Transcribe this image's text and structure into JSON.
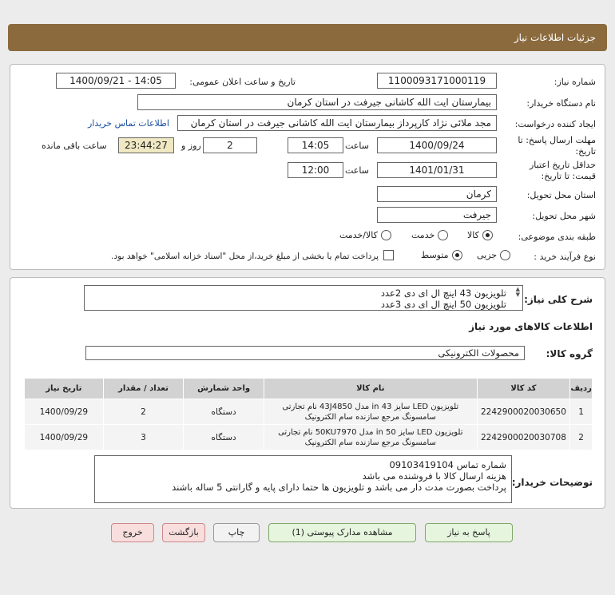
{
  "header": {
    "title": "جزئیات اطلاعات نیاز"
  },
  "form": {
    "need_number": {
      "label": "شماره نیاز:",
      "value": "1100093171000119"
    },
    "announce_datetime": {
      "label": "تاریخ و ساعت اعلان عمومی:",
      "value": "1400/09/21 - 14:05"
    },
    "buyer_org": {
      "label": "نام دستگاه خریدار:",
      "value": "بیمارستان ایت الله کاشانی جیرفت در استان کرمان"
    },
    "requester": {
      "label": "ایجاد کننده درخواست:",
      "value": "مجد ملائی نژاد کارپرداز بیمارستان ایت الله کاشانی جیرفت در استان کرمان",
      "contact_link": "اطلاعات تماس خریدار"
    },
    "reply_deadline": {
      "label_line1": "مهلت ارسال پاسخ: تا",
      "label_line2": "تاریخ:",
      "date": "1400/09/24",
      "time_label": "ساعت",
      "time": "14:05",
      "days": "2",
      "days_label": "روز و",
      "remaining": "23:44:27",
      "remaining_label": "ساعت باقی مانده"
    },
    "price_validity": {
      "label_line1": "حداقل تاریخ اعتبار",
      "label_line2": "قیمت: تا تاریخ:",
      "date": "1401/01/31",
      "time_label": "ساعت",
      "time": "12:00"
    },
    "delivery_province": {
      "label": "استان محل تحویل:",
      "value": "کرمان"
    },
    "delivery_city": {
      "label": "شهر محل تحویل:",
      "value": "جیرفت"
    },
    "category": {
      "label": "طبقه بندی موضوعی:",
      "options": [
        "کالا",
        "خدمت",
        "کالا/خدمت"
      ],
      "selected": "کالا"
    },
    "purchase_process": {
      "label": "نوع فرآیند خرید :",
      "options": [
        "جزیی",
        "متوسط"
      ],
      "selected": "متوسط",
      "note": "پرداخت تمام یا بخشی از مبلغ خرید،از محل \"اسناد خزانه اسلامی\" خواهد بود."
    }
  },
  "summary": {
    "label": "شرح کلی نیاز:",
    "lines": [
      "تلویزیون 43 اینچ ال ای دی 2عدد",
      "تلویزیون 50 اینچ ال ای دی 3عدد"
    ]
  },
  "goods": {
    "section_title": "اطلاعات کالاهای مورد نیاز",
    "group_label": "گروه کالا:",
    "group_value": "محصولات الکترونیکی",
    "columns": [
      "ردیف",
      "کد کالا",
      "نام کالا",
      "واحد شمارش",
      "تعداد / مقدار",
      "تاریخ نیاز"
    ],
    "rows": [
      {
        "row": "1",
        "code": "2242900020030650",
        "name": "تلویزیون LED سایز 43 in مدل 43J4850 نام تجارتی سامسونگ مرجع سازنده سام الکترونیک",
        "unit": "دستگاه",
        "qty": "2",
        "date": "1400/09/29"
      },
      {
        "row": "2",
        "code": "2242900020030708",
        "name": "تلویزیون LED سایز 50 in مدل 50KU7970 نام تجارتی سامسونگ مرجع سازنده سام الکترونیک",
        "unit": "دستگاه",
        "qty": "3",
        "date": "1400/09/29"
      }
    ]
  },
  "buyer_notes": {
    "label": "توضیحات خریدار:",
    "lines": [
      "شماره تماس 09103419104",
      "هزینه ارسال کالا با فروشنده می باشد",
      "پرداخت بصورت مدت دار می باشد و تلویزیون ها حتما دارای پایه و گارانتی 5 ساله باشند"
    ]
  },
  "buttons": {
    "reply": "پاسخ به نیاز",
    "attachments": "مشاهده مدارک پیوستی (1)",
    "print": "چاپ",
    "back": "بازگشت",
    "exit": "خروج"
  },
  "colors": {
    "header_bg": "#8b6a3e",
    "remaining_bg": "#efe8c2",
    "link": "#1a4fa0"
  }
}
